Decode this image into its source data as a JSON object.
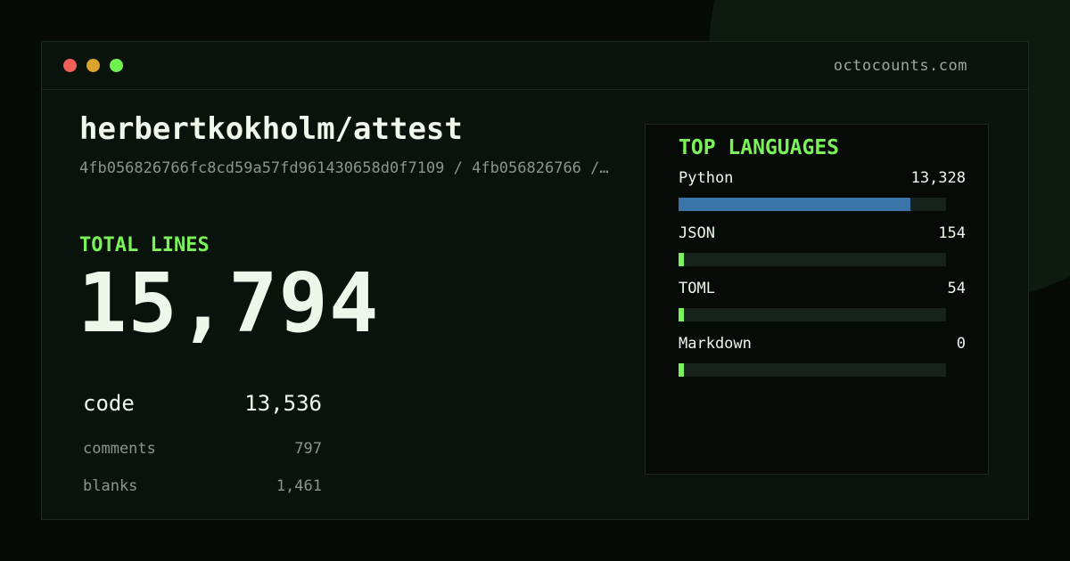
{
  "site": "octocounts.com",
  "repo": "herbertkokholm/attest",
  "commit": "4fb056826766fc8cd59a57fd961430658d0f7109 / 4fb056826766 /…",
  "total": {
    "label": "TOTAL LINES",
    "value": "15,794"
  },
  "stats": [
    {
      "name": "code",
      "value": "13,536"
    },
    {
      "name": "comments",
      "value": "797"
    },
    {
      "name": "blanks",
      "value": "1,461"
    }
  ],
  "languages": {
    "title": "TOP LANGUAGES",
    "items": [
      {
        "name": "Python",
        "value": "13,328",
        "fraction": 0.867,
        "color": "#3b74a8"
      },
      {
        "name": "JSON",
        "value": "154",
        "fraction": 0.0,
        "color": "#7cf25a"
      },
      {
        "name": "TOML",
        "value": "54",
        "fraction": 0.0,
        "color": "#7cf25a"
      },
      {
        "name": "Markdown",
        "value": "0",
        "fraction": 0.0,
        "color": "#7cf25a"
      }
    ]
  },
  "window_controls": [
    "close-dot",
    "minimize-dot",
    "maximize-dot"
  ]
}
